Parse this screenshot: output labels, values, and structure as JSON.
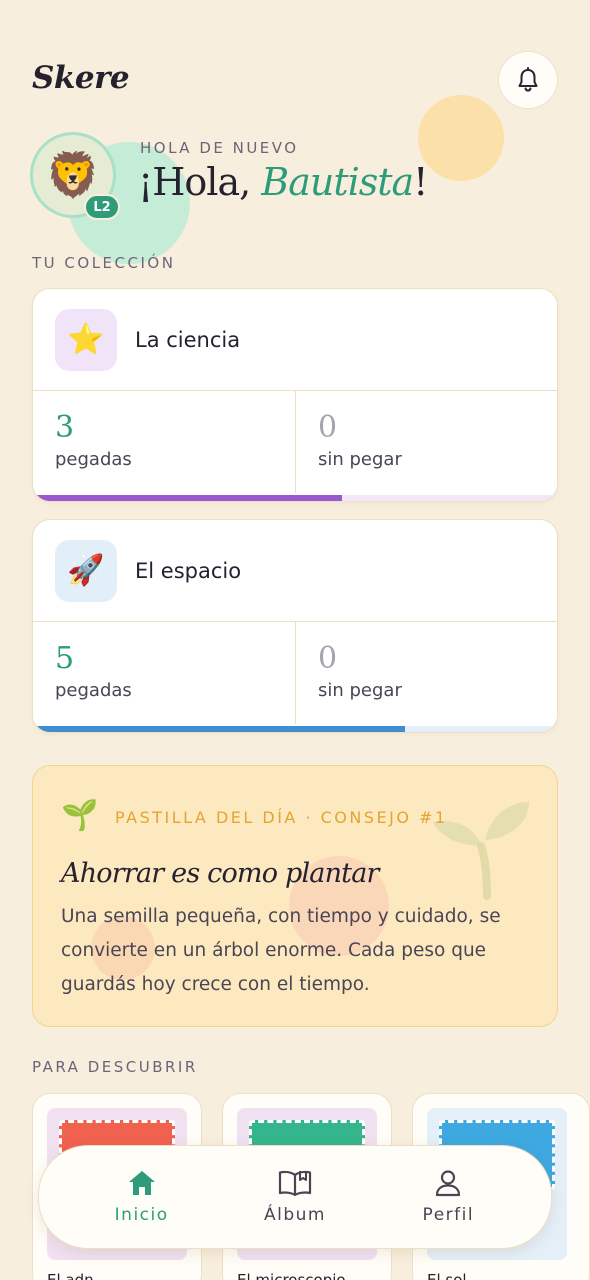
{
  "app": {
    "title": "Skere"
  },
  "header": {
    "bell_icon": "bell-icon"
  },
  "user": {
    "avatar_emoji": "🦁",
    "level": "L2",
    "greeting_eyebrow": "HOLA DE NUEVO",
    "greeting_prefix": "¡Hola, ",
    "name": "Bautista",
    "greeting_suffix": "!"
  },
  "collection": {
    "label": "TU COLECCIÓN",
    "cards": [
      {
        "icon": "⭐",
        "icon_name": "star-icon",
        "title": "La ciencia",
        "pasted_value": "3",
        "pasted_label": "pegadas",
        "unpasted_value": "0",
        "unpasted_label": "sin pegar",
        "progress": 0.59,
        "accent": "#9b59d0",
        "icon_bg": "#f1e4f8",
        "track": "#f2e6f7"
      },
      {
        "icon": "🚀",
        "icon_name": "rocket-icon",
        "title": "El espacio",
        "pasted_value": "5",
        "pasted_label": "pegadas",
        "unpasted_value": "0",
        "unpasted_label": "sin pegar",
        "progress": 0.71,
        "accent": "#3d8fd0",
        "icon_bg": "#e3eff8",
        "track": "#e4eff8"
      }
    ]
  },
  "tip": {
    "icon": "🌱",
    "eyebrow": "PASTILLA DEL DÍA · CONSEJO #1",
    "title": "Ahorrar es como plantar",
    "body": "Una semilla pequeña, con tiempo y cuidado, se convierte en un árbol enorme. Cada peso que guardás hoy crece con el tiempo."
  },
  "discover": {
    "label": "PARA DESCUBRIR",
    "items": [
      {
        "label": "El adn",
        "bg": "#f0e0f0",
        "stamp": "#f0614f"
      },
      {
        "label": "El microscopio",
        "bg": "#efe0f2",
        "stamp": "#35b58b"
      },
      {
        "label": "El sol",
        "bg": "#e4eff8",
        "stamp": "#3ea8e0"
      }
    ]
  },
  "nav": {
    "items": [
      {
        "label": "Inicio",
        "icon": "home-icon",
        "active": true
      },
      {
        "label": "Álbum",
        "icon": "book-icon",
        "active": false
      },
      {
        "label": "Perfil",
        "icon": "user-icon",
        "active": false
      }
    ]
  },
  "colors": {
    "background": "#f8eedd",
    "primary": "#2e9c7b",
    "tip_accent": "#e5a432"
  }
}
